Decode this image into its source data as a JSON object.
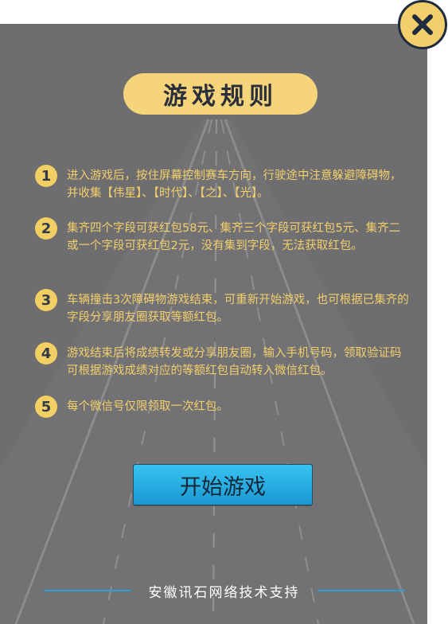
{
  "title": "游戏规则",
  "rules": [
    {
      "num": "1",
      "text": "进入游戏后，按住屏幕控制赛车方向，行驶途中注意躲避障碍物，并收集【伟星】、【时代】、【之】、【光】。"
    },
    {
      "num": "2",
      "text": "集齐四个字段可获红包58元、集齐三个字段可获红包5元、集齐二或一个字段可获红包2元，没有集到字段，无法获取红包。"
    },
    {
      "num": "3",
      "text": "车辆撞击3次障碍物游戏结束，可重新开始游戏，也可根据已集齐的字段分享朋友圈获取等额红包。"
    },
    {
      "num": "4",
      "text": "游戏结束后将成绩转发或分享朋友圈，输入手机号码，领取验证码可根据游戏成绩对应的等额红包自动转入微信红包。"
    },
    {
      "num": "5",
      "text": "每个微信号仅限领取一次红包。"
    }
  ],
  "start_button": "开始游戏",
  "footer": "安徽讯石网络技术支持",
  "icons": {
    "close": "close-icon"
  },
  "colors": {
    "panel": "#6e6e70",
    "accent": "#f3cf6b",
    "button": "#1a98d3"
  }
}
